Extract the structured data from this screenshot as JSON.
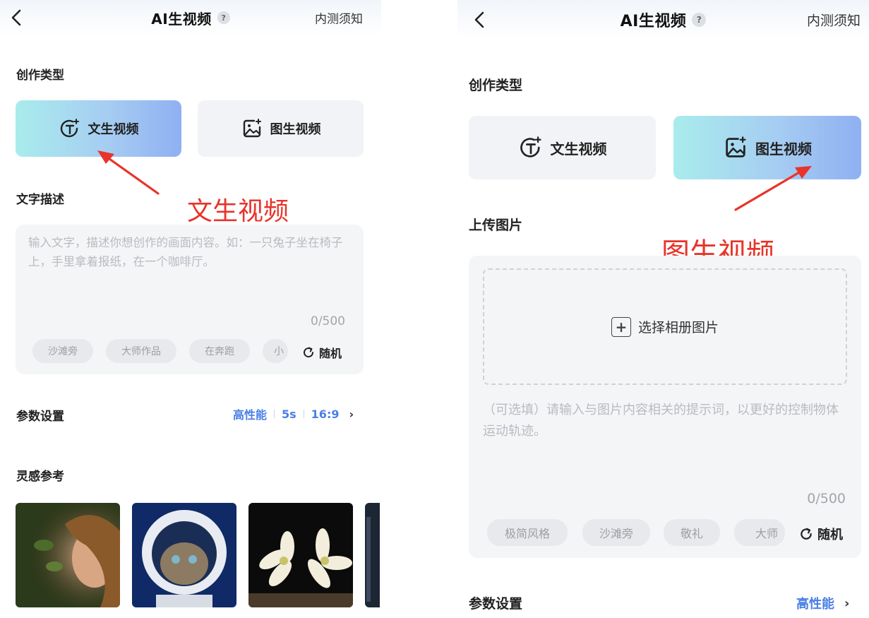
{
  "left": {
    "header": {
      "title": "AI生视频",
      "help": "?",
      "notice": "内测须知"
    },
    "type_section_label": "创作类型",
    "types": [
      {
        "label": "文生视频"
      },
      {
        "label": "图生视频"
      }
    ],
    "desc_label": "文字描述",
    "annotation": "文生视频",
    "textarea": {
      "placeholder": "输入文字，描述你想创作的画面内容。如：一只兔子坐在椅子上，手里拿着报纸，在一个咖啡厅。",
      "counter": "0/500"
    },
    "chips": [
      "沙滩旁",
      "大师作品",
      "在奔跑",
      "小"
    ],
    "random": "随机",
    "params": {
      "label": "参数设置",
      "quality": "高性能",
      "duration": "5s",
      "ratio": "16:9"
    },
    "inspiration_label": "灵感参考"
  },
  "right": {
    "header": {
      "title": "AI生视频",
      "help": "?",
      "notice": "内测须知"
    },
    "type_section_label": "创作类型",
    "types": [
      {
        "label": "文生视频"
      },
      {
        "label": "图生视频"
      }
    ],
    "upload_label": "上传图片",
    "annotation": "图生视频",
    "upload_button": "选择相册图片",
    "textarea": {
      "placeholder": "（可选填）请输入与图片内容相关的提示词，以更好的控制物体运动轨迹。",
      "counter": "0/500"
    },
    "chips": [
      "极简风格",
      "沙滩旁",
      "敬礼",
      "大师"
    ],
    "random": "随机",
    "params": {
      "label": "参数设置",
      "quality": "高性能"
    }
  },
  "colors": {
    "accent": "#4a7fe6",
    "annotation": "#e8342a",
    "active_gradient_start": "#a9ecec",
    "active_gradient_end": "#8fb0f2"
  },
  "icons": {
    "back": "chevron-left-icon",
    "text_video": "text-video-icon",
    "image_video": "image-video-icon",
    "random": "refresh-icon",
    "plus": "plus-box-icon"
  }
}
